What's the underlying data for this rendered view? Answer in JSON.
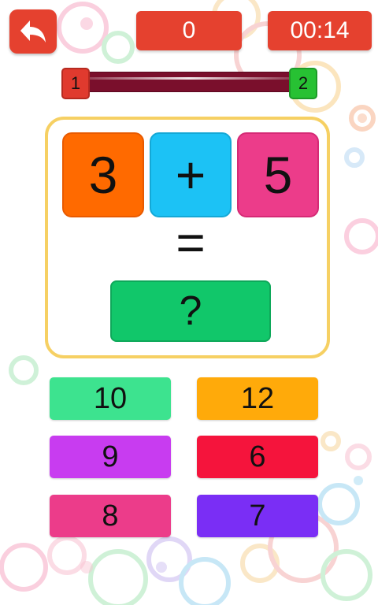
{
  "header": {
    "score": "0",
    "timer": "00:14"
  },
  "progress": {
    "start_label": "1",
    "end_label": "2",
    "fraction_complete": 0.0
  },
  "equation": {
    "left": "3",
    "operator": "+",
    "right": "5",
    "equals": "=",
    "answer": "?"
  },
  "options": [
    {
      "label": "10",
      "color": "#3de38f"
    },
    {
      "label": "12",
      "color": "#ffaa0a"
    },
    {
      "label": "9",
      "color": "#c83cf0"
    },
    {
      "label": "6",
      "color": "#f5143c"
    },
    {
      "label": "8",
      "color": "#ec3c8a"
    },
    {
      "label": "7",
      "color": "#7a2ef5"
    }
  ],
  "icons": {
    "back": "back-arrow-icon"
  },
  "colors": {
    "header_button": "#e5412f",
    "panel_border": "#f6d063",
    "track": "#7a0f2c",
    "node_start": "#e03a2e",
    "node_end": "#27c133",
    "tile_left": "#ff6a00",
    "tile_operator": "#1cc2f5",
    "tile_right": "#ec3c8a",
    "answer_box": "#11c76a"
  }
}
